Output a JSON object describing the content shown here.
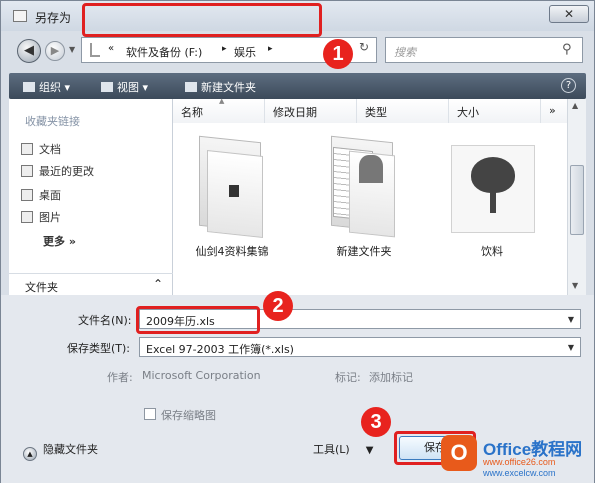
{
  "window": {
    "title": "另存为",
    "close_glyph": "✕"
  },
  "address": {
    "arrows": "«",
    "segments": [
      "软件及备份 (F:)",
      "娱乐"
    ],
    "separator": "▸",
    "drop_glyph": "▾",
    "refresh_glyph": "↻"
  },
  "search": {
    "placeholder": "搜索",
    "icon": "search-icon"
  },
  "toolbar": {
    "organize": "组织 ▾",
    "views": "视图 ▾",
    "new_folder": "新建文件夹",
    "help": "?"
  },
  "sidebar": {
    "header": "收藏夹链接",
    "items": [
      {
        "label": "文档",
        "icon": "documents-icon"
      },
      {
        "label": "最近的更改",
        "icon": "recent-icon"
      },
      {
        "label": "桌面",
        "icon": "desktop-icon"
      },
      {
        "label": "图片",
        "icon": "pictures-icon"
      }
    ],
    "more": "更多 »",
    "folder_label": "文件夹",
    "folder_chevron": "⌃"
  },
  "columns": [
    "名称",
    "修改日期",
    "类型",
    "大小"
  ],
  "columns_more": "»",
  "files": [
    {
      "name": "仙剑4资料集锦",
      "type": "folder"
    },
    {
      "name": "新建文件夹",
      "type": "folder"
    },
    {
      "name": "饮料",
      "type": "image"
    }
  ],
  "form": {
    "filename_label": "文件名(N):",
    "filename_value": "2009年历.xls",
    "filetype_label": "保存类型(T):",
    "filetype_value": "Excel 97-2003 工作簿(*.xls)",
    "author_label": "作者:",
    "author_value": "Microsoft Corporation",
    "tags_label": "标记:",
    "tags_value": "添加标记",
    "thumbnail_label": "保存缩略图",
    "hide_folders": "隐藏文件夹",
    "tools": "工具(L)",
    "tools_drop": "▼",
    "save": "保存"
  },
  "badges": [
    "1",
    "2",
    "3"
  ],
  "watermark": {
    "logo": "O",
    "title": "Office教程网",
    "url1": "www.office26.com",
    "url2": "www.excelcw.com"
  },
  "colors": {
    "highlight": "#e02020",
    "badge": "#e8231e",
    "toolbar": "#4a596b"
  }
}
